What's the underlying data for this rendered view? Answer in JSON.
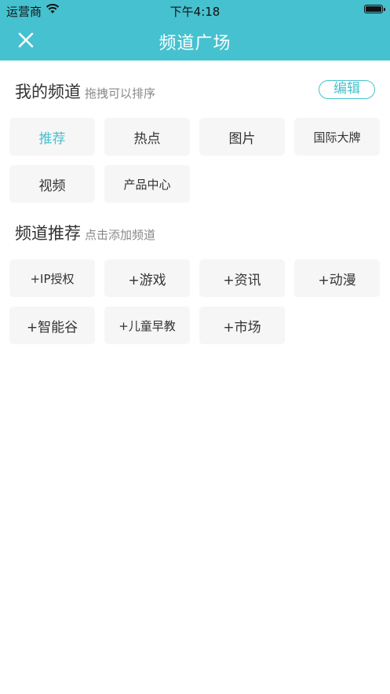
{
  "status_bar": {
    "carrier": "运营商",
    "time": "下午4:18"
  },
  "nav": {
    "title": "频道广场"
  },
  "my_channels": {
    "title": "我的频道",
    "hint": "拖拽可以排序",
    "edit_label": "编辑",
    "items": [
      {
        "label": "推荐",
        "active": true
      },
      {
        "label": "热点",
        "active": false
      },
      {
        "label": "图片",
        "active": false
      },
      {
        "label": "国际大牌",
        "active": false
      },
      {
        "label": "视频",
        "active": false
      },
      {
        "label": "产品中心",
        "active": false
      }
    ]
  },
  "recommended": {
    "title": "频道推荐",
    "hint": "点击添加频道",
    "items": [
      {
        "label": "+IP授权"
      },
      {
        "label": "+游戏"
      },
      {
        "label": "+资讯"
      },
      {
        "label": "+动漫"
      },
      {
        "label": "+智能谷"
      },
      {
        "label": "+儿童早教"
      },
      {
        "label": "+市场"
      }
    ]
  },
  "colors": {
    "accent": "#46c1cf",
    "tag_bg": "#f6f6f6"
  }
}
